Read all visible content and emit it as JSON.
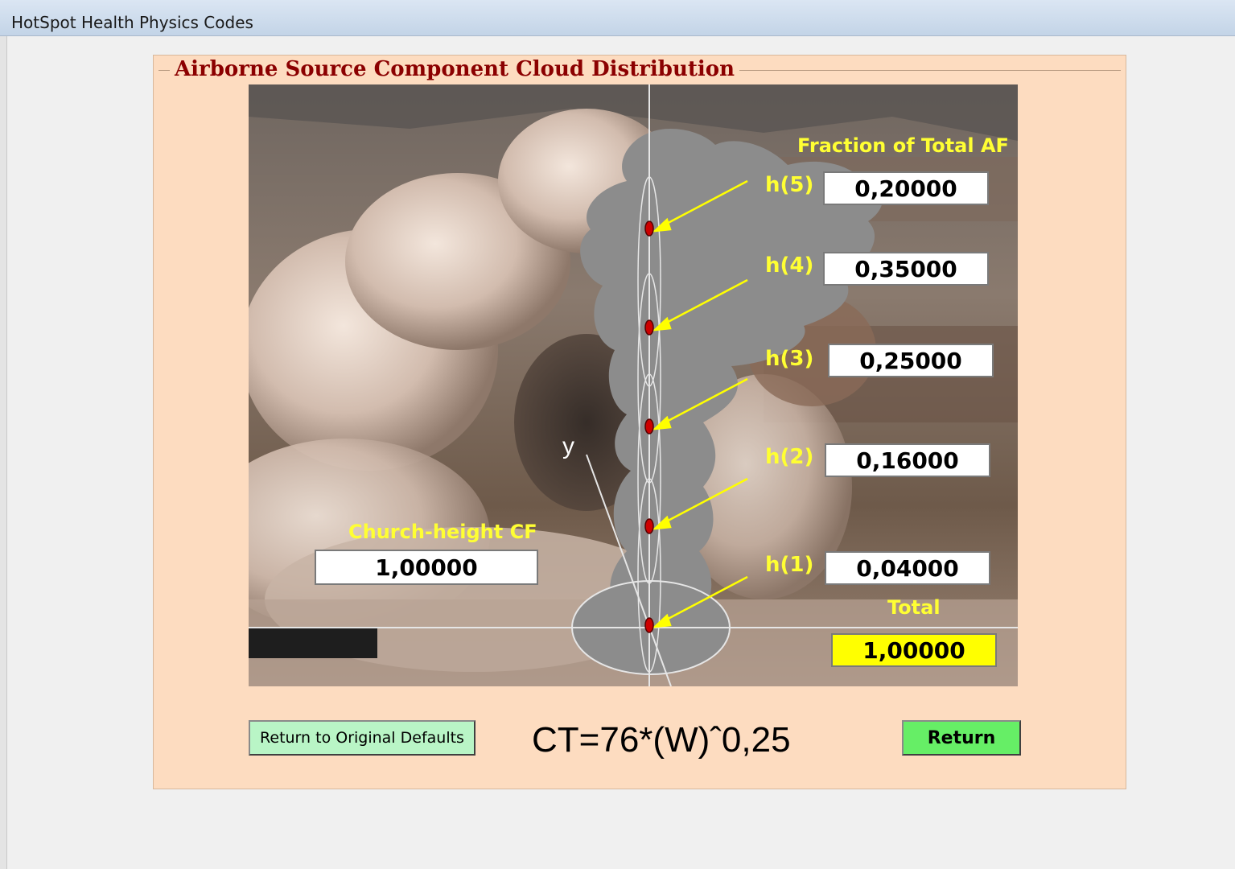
{
  "window": {
    "title": "HotSpot Health Physics Codes"
  },
  "panel": {
    "title": "Airborne  Source Component Cloud Distribution",
    "fraction_label": "Fraction of Total AF",
    "church_label": "Church-height CF",
    "church_value": "1,00000",
    "y_axis_label": "y",
    "total_label": "Total",
    "total_value": "1,00000",
    "components": [
      {
        "label": "h(5)",
        "value": "0,20000"
      },
      {
        "label": "h(4)",
        "value": "0,35000"
      },
      {
        "label": "h(3)",
        "value": "0,25000"
      },
      {
        "label": "h(2)",
        "value": "0,16000"
      },
      {
        "label": "h(1)",
        "value": "0,04000"
      }
    ],
    "formula": "CT=76*(W)ˆ0,25"
  },
  "buttons": {
    "defaults_label": "Return to Original Defaults",
    "return_label": "Return"
  },
  "colors": {
    "panel_bg": "#fddcc0",
    "title_color": "#8b0000",
    "label_yellow": "#ffff33",
    "total_field": "#ffff00",
    "return_button": "#66ee66",
    "defaults_button": "#b9f5c6"
  }
}
